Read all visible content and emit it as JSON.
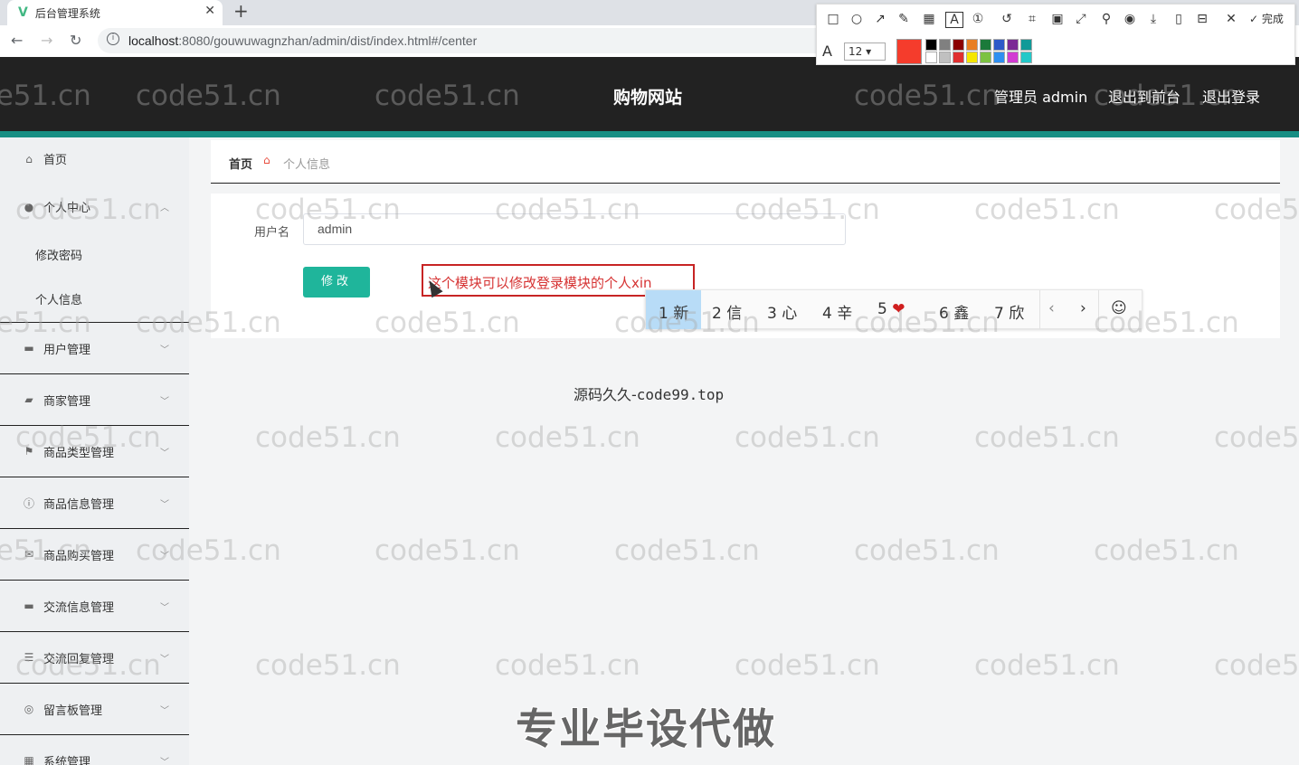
{
  "browser": {
    "tab_title": "后台管理系统",
    "tab_logo": "V",
    "url_host": "localhost",
    "url_rest": ":8080/gouwuwagnzhan/admin/dist/index.html#/center"
  },
  "annotation_toolbar": {
    "font_size": "12",
    "done_label": "完成",
    "current_color": "#f53c2c",
    "palette": [
      "#000000",
      "#808080",
      "#8b0000",
      "#e87e22",
      "#1b7a3a",
      "#2d5ac8",
      "#7b2a95",
      "#119a98",
      "#ffffff",
      "#c0c0c0",
      "#e03030",
      "#f5e600",
      "#7cc242",
      "#2f8ff0",
      "#d23bd2",
      "#23c8c8"
    ]
  },
  "header": {
    "site_title": "购物网站",
    "user_label": "管理员 admin",
    "back_label": "退出到前台",
    "logout_label": "退出登录"
  },
  "sidebar": {
    "home": "首页",
    "personal_center": "个人中心",
    "sub_change_password": "修改密码",
    "sub_personal_info": "个人信息",
    "items": [
      "用户管理",
      "商家管理",
      "商品类型管理",
      "商品信息管理",
      "商品购买管理",
      "交流信息管理",
      "交流回复管理",
      "留言板管理",
      "系统管理"
    ]
  },
  "breadcrumb": {
    "home": "首页",
    "current": "个人信息"
  },
  "form": {
    "username_label": "用户名",
    "username_value": "admin",
    "submit_label": "修改"
  },
  "text_annotation": "这个模块可以修改登录模块的个人xin",
  "ime": {
    "candidates": [
      "1 新",
      "2 信",
      "3 心",
      "4 辛",
      "5",
      "6 鑫",
      "7 欣"
    ],
    "heart": "❤"
  },
  "footer_text": "源码久久-",
  "footer_mono": "code99.top",
  "promo": "专业毕设代做",
  "watermark": "code51.cn"
}
